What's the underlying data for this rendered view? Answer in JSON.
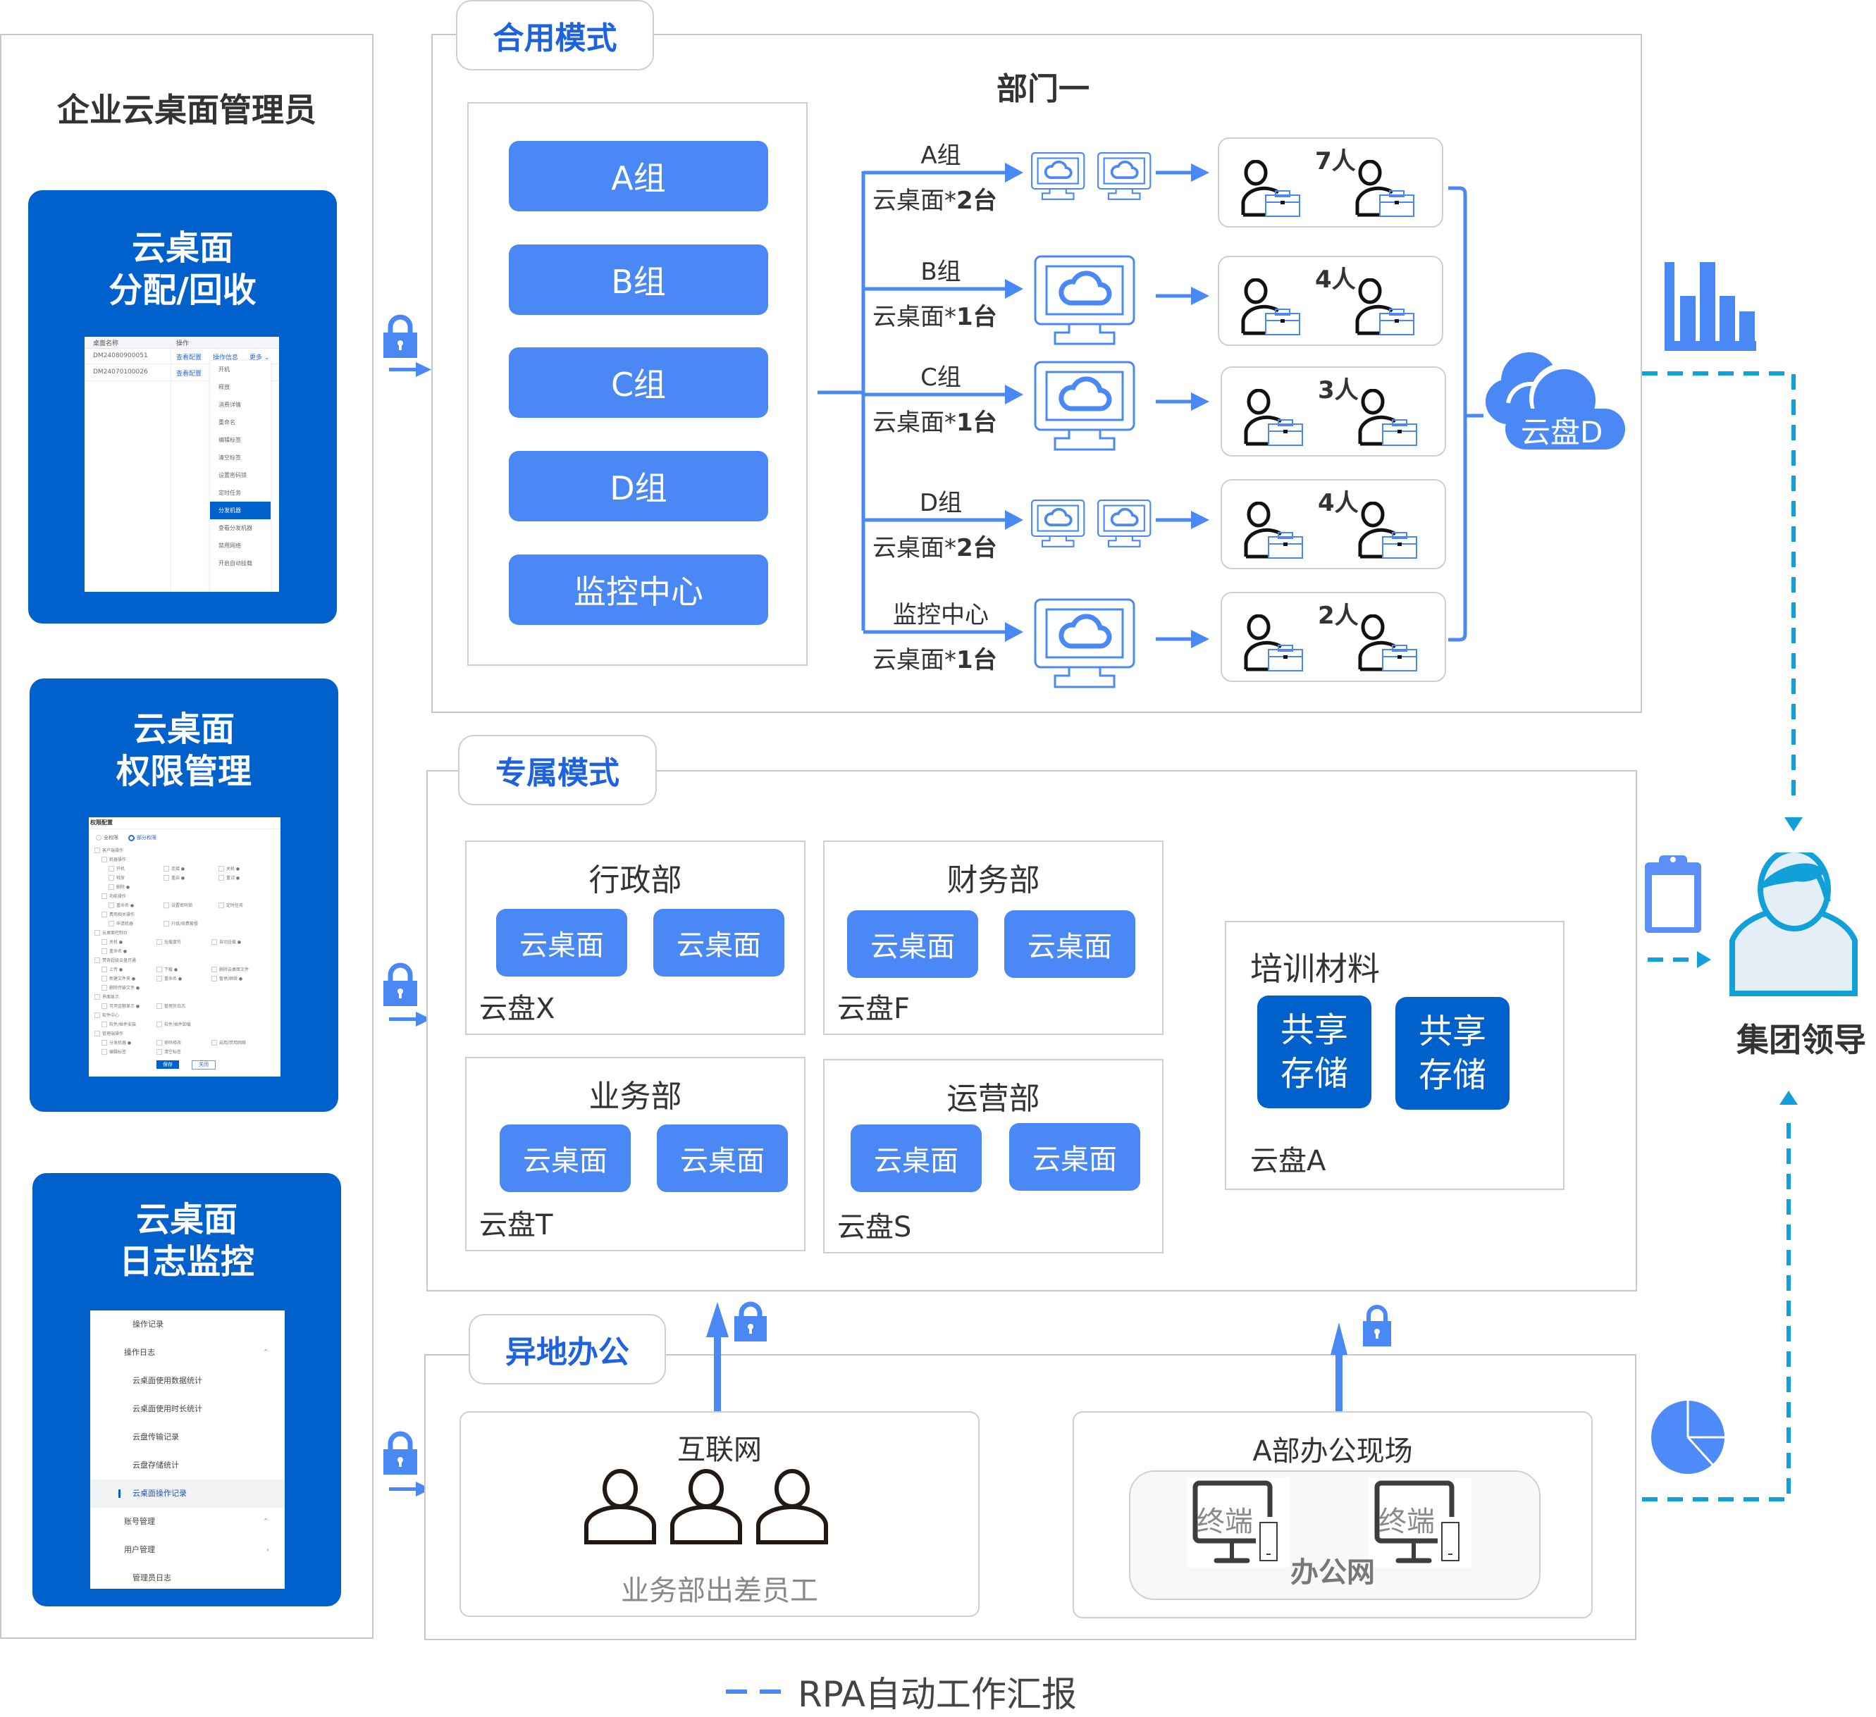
{
  "admin": {
    "title": "企业云桌面管理员",
    "cards": [
      {
        "title_line1": "云桌面",
        "title_line2": "分配/回收",
        "mock": {
          "col_name": "桌面名称",
          "col_action": "操作",
          "rows": [
            {
              "name": "DM24080900051",
              "actions": [
                "查看配置",
                "操作信息",
                "更多 ⌄"
              ]
            },
            {
              "name": "DM24070100026",
              "actions": [
                "查看配置"
              ]
            }
          ],
          "menu": [
            "开机",
            "释放",
            "消费详情",
            "重命名",
            "编辑标签",
            "清空标签",
            "设置密码锁",
            "定时任务",
            "分发机器",
            "查看分发机器",
            "禁用网络",
            "开启自动挂载"
          ],
          "menu_selected": "分发机器"
        }
      },
      {
        "title_line1": "云桌面",
        "title_line2": "权限管理",
        "mock": {
          "header": "权限配置",
          "radio_full": "全权限",
          "radio_partial": "部分权限",
          "tree": [
            {
              "level": 0,
              "items": [
                "客户端操作"
              ]
            },
            {
              "level": 1,
              "items": [
                "机器操作"
              ]
            },
            {
              "level": 2,
              "items": [
                "开机",
                "连接 ●",
                "关机 ●"
              ]
            },
            {
              "level": 2,
              "items": [
                "释放",
                "重启 ●",
                "重试 ●"
              ]
            },
            {
              "level": 2,
              "items": [
                "删除 ●"
              ]
            },
            {
              "level": 1,
              "items": [
                "功能操作"
              ]
            },
            {
              "level": 2,
              "items": [
                "重命名 ●",
                "设置密码锁",
                "定时任务"
              ]
            },
            {
              "level": 1,
              "items": [
                "费用相关操作"
              ]
            },
            {
              "level": 2,
              "items": [
                "申请机器",
                "升级/续费套餐"
              ]
            },
            {
              "level": 0,
              "items": [
                "云桌面控制台"
              ]
            },
            {
              "level": 1,
              "items": [
                "关机 ●",
                "挂载盘符",
                "自动挂载 ●"
              ]
            },
            {
              "level": 1,
              "items": [
                "重命名 ●"
              ]
            },
            {
              "level": 0,
              "items": [
                "赞奇超级云盘开通"
              ]
            },
            {
              "level": 1,
              "items": [
                "上传 ●",
                "下载 ●",
                "删除云桌面文件"
              ]
            },
            {
              "level": 1,
              "items": [
                "新建文件夹 ●",
                "重命名 ●",
                "暂停/继续 ●"
              ]
            },
            {
              "level": 1,
              "items": [
                "删除传输文件 ●"
              ]
            },
            {
              "level": 0,
              "items": [
                "界面显示"
              ]
            },
            {
              "level": 1,
              "items": [
                "可用金额显示 ●",
                "管理员日志"
              ]
            },
            {
              "level": 0,
              "items": [
                "软件中心"
              ]
            },
            {
              "level": 1,
              "items": [
                "软件/插件安装",
                "软件/插件卸载"
              ]
            },
            {
              "level": 0,
              "items": [
                "管理端操作"
              ]
            },
            {
              "level": 1,
              "items": [
                "分发机器 ●",
                "密码修改",
                "启用/禁用网络"
              ]
            },
            {
              "level": 1,
              "items": [
                "编辑标签",
                "清空标签"
              ]
            }
          ],
          "save": "保存",
          "close": "关闭"
        }
      },
      {
        "title_line1": "云桌面",
        "title_line2": "日志监控",
        "mock": {
          "items": [
            {
              "label": "操作记录",
              "indent": true,
              "arrow": ""
            },
            {
              "label": "操作日志",
              "indent": false,
              "arrow": "⌃"
            },
            {
              "label": "云桌面使用数据统计",
              "indent": true,
              "arrow": ""
            },
            {
              "label": "云桌面使用时长统计",
              "indent": true,
              "arrow": ""
            },
            {
              "label": "云盘传输记录",
              "indent": true,
              "arrow": ""
            },
            {
              "label": "云盘存储统计",
              "indent": true,
              "arrow": ""
            },
            {
              "label": "云桌面操作记录",
              "indent": true,
              "arrow": "",
              "active": true
            },
            {
              "label": "账号管理",
              "indent": false,
              "arrow": "⌃"
            },
            {
              "label": "用户管理",
              "indent": false,
              "arrow": "›"
            },
            {
              "label": "管理员日志",
              "indent": true,
              "arrow": ""
            }
          ]
        }
      }
    ]
  },
  "shared_mode": {
    "tag": "合用模式",
    "department": "部门一",
    "groups": [
      "A组",
      "B组",
      "C组",
      "D组",
      "监控中心"
    ],
    "branches": [
      {
        "label": "A组",
        "desktop_text": "云桌面*",
        "count_text": "2台",
        "monitors": 2,
        "people": "7人"
      },
      {
        "label": "B组",
        "desktop_text": "云桌面*",
        "count_text": "1台",
        "monitors": 1,
        "people": "4人"
      },
      {
        "label": "C组",
        "desktop_text": "云桌面*",
        "count_text": "1台",
        "monitors": 1,
        "people": "3人"
      },
      {
        "label": "D组",
        "desktop_text": "云桌面*",
        "count_text": "2台",
        "monitors": 2,
        "people": "4人"
      },
      {
        "label": "监控中心",
        "desktop_text": "云桌面*",
        "count_text": "1台",
        "monitors": 1,
        "people": "2人"
      }
    ],
    "cloud_disk": "云盘D"
  },
  "dedicated_mode": {
    "tag": "专属模式",
    "departments": [
      {
        "name": "行政部",
        "desktops": [
          "云桌面",
          "云桌面"
        ],
        "disk": "云盘X"
      },
      {
        "name": "财务部",
        "desktops": [
          "云桌面",
          "云桌面"
        ],
        "disk": "云盘F"
      },
      {
        "name": "业务部",
        "desktops": [
          "云桌面",
          "云桌面"
        ],
        "disk": "云盘T"
      },
      {
        "name": "运营部",
        "desktops": [
          "云桌面",
          "云桌面"
        ],
        "disk": "云盘S"
      }
    ],
    "training": {
      "title": "培训材料",
      "shares": [
        "共享\n存储",
        "共享\n存储"
      ],
      "disk": "云盘A"
    }
  },
  "remote_mode": {
    "tag": "异地办公",
    "internet": {
      "title": "互联网",
      "caption": "业务部出差员工"
    },
    "office": {
      "title": "A部办公现场",
      "terminals": [
        "终端",
        "终端"
      ],
      "network": "办公网"
    }
  },
  "leader": {
    "label": "集团领导"
  },
  "legend": {
    "label": "RPA自动工作汇报"
  },
  "colors": {
    "brand_dark": "#0060cc",
    "accent_blue": "#4a88f5",
    "tag_text": "#1f62e0",
    "rpa_dashed": "#12a0d8",
    "border": "#cfcfcf"
  }
}
